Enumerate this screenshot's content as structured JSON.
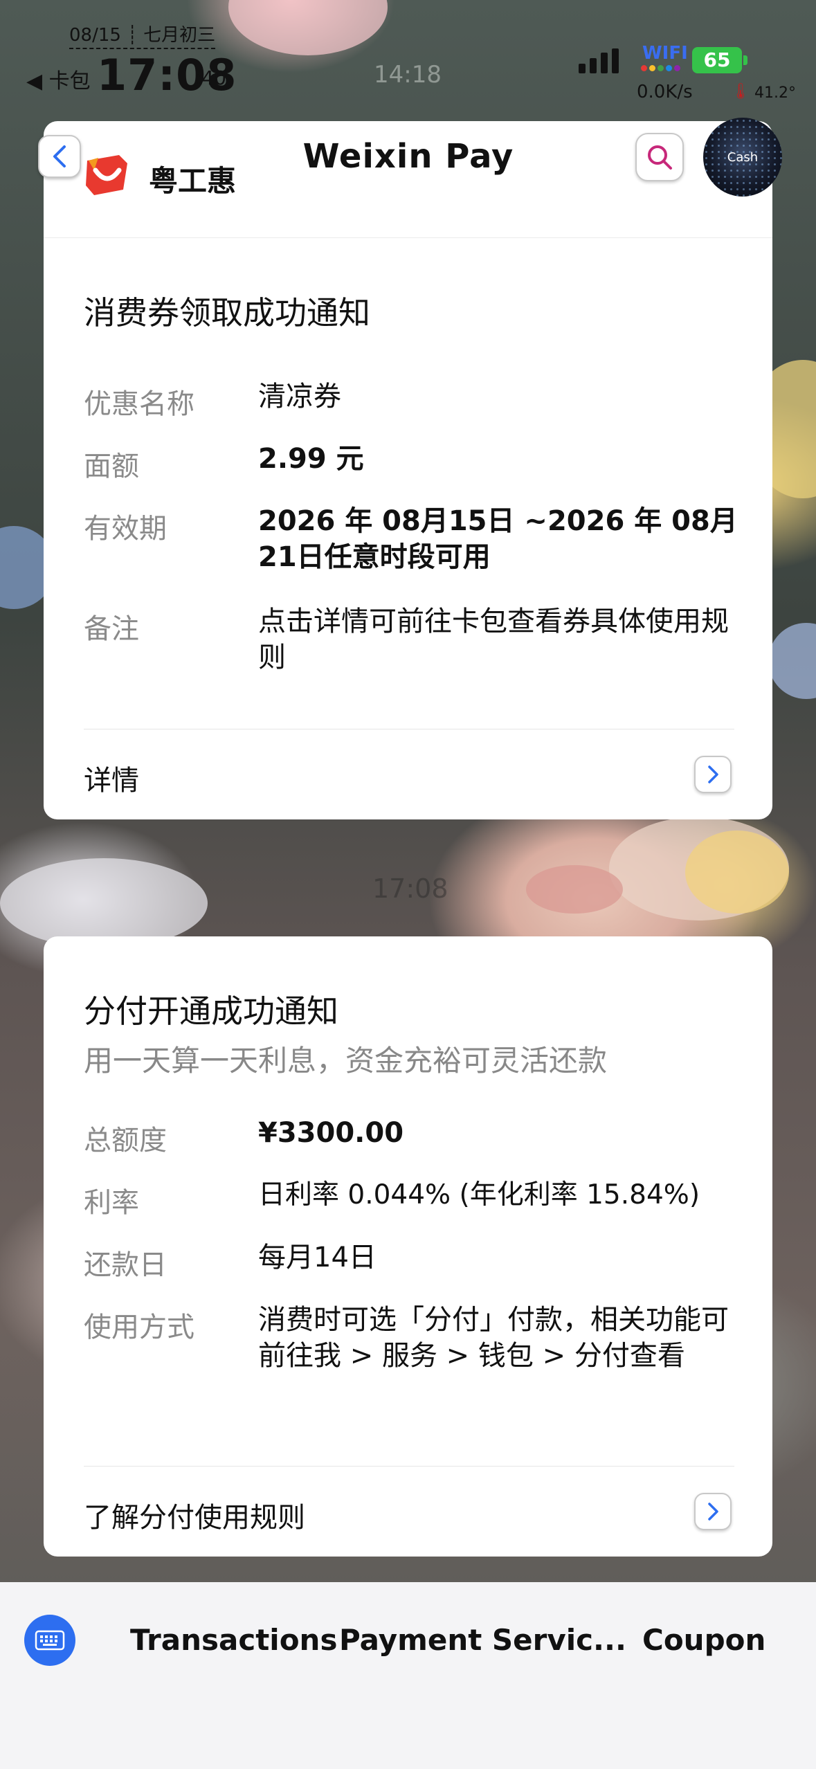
{
  "status_bar": {
    "date": "08/15 ┊ 七月初三",
    "back_app": "◀ 卡包",
    "time": "17:08",
    "seconds": ":40",
    "ghost_time": "14:18",
    "wifi_label": "WIFI",
    "battery": "65",
    "net_speed": "0.0K/s",
    "temperature": "41.2°"
  },
  "header": {
    "brand": "粤工惠",
    "title": "Weixin Pay",
    "cash_badge": "Cash"
  },
  "card1": {
    "title": "消费券领取成功通知",
    "rows": [
      {
        "label": "优惠名称",
        "value": "清凉券"
      },
      {
        "label": "面额",
        "value": "2.99 元"
      },
      {
        "label": "有效期",
        "value": "2026 年 08月15日 ~2026 年 08月21日任意时段可用"
      },
      {
        "label": "备注",
        "value": "点击详情可前往卡包查看券具体使用规则"
      }
    ],
    "link": "详情"
  },
  "mid_time": "17:08",
  "card2": {
    "title": "分付开通成功通知",
    "subtitle": "用一天算一天利息，资金充裕可灵活还款",
    "rows": [
      {
        "label": "总额度",
        "value": "¥3300.00"
      },
      {
        "label": "利率",
        "value": "日利率 0.044% (年化利率 15.84%)"
      },
      {
        "label": "还款日",
        "value": "每月14日"
      },
      {
        "label": "使用方式",
        "value": "消费时可选「分付」付款，相关功能可前往我 > 服务 > 钱包 > 分付查看"
      }
    ],
    "link": "了解分付使用规则"
  },
  "bottom_bar": {
    "tabs": [
      "Transactions",
      "Payment Servic...",
      "Coupon"
    ]
  },
  "colors": {
    "accent_blue": "#2d6ef0",
    "battery_green": "#35c24a",
    "logo_red": "#e8392f"
  }
}
